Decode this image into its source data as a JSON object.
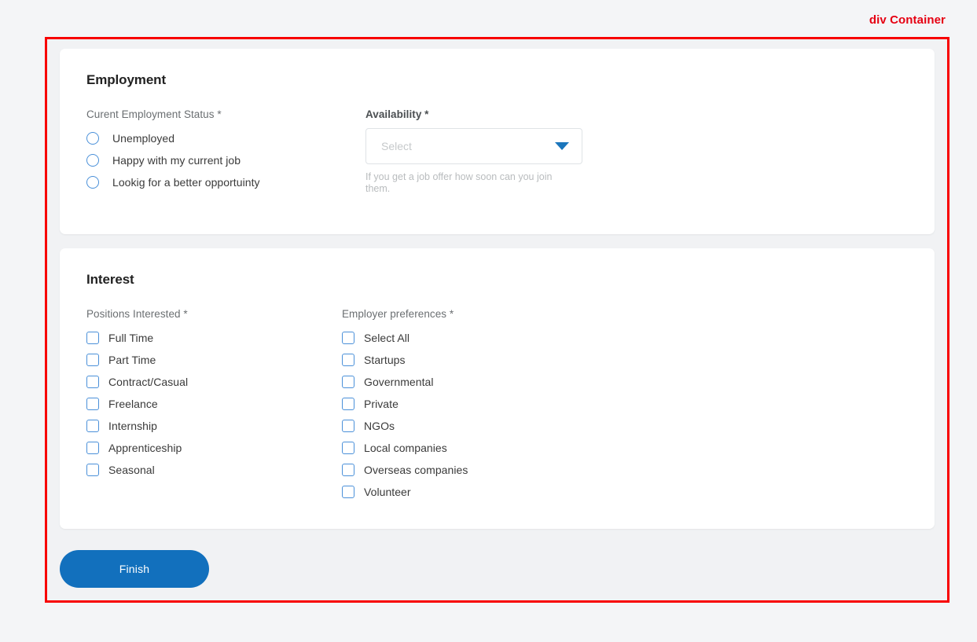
{
  "annotation": {
    "label": "div Container",
    "color": "#e60012"
  },
  "theme": {
    "page_background": "#f4f5f7",
    "container_border": "#f80000",
    "card_background": "#ffffff",
    "accent_blue": "#1270bd",
    "control_border_blue": "#4a90d9"
  },
  "employment_section": {
    "title": "Employment",
    "status_field": {
      "label": "Curent Employment Status *",
      "options": [
        {
          "label": "Unemployed",
          "selected": false
        },
        {
          "label": "Happy with my current job",
          "selected": false
        },
        {
          "label": "Lookig for a better opportuinty",
          "selected": false
        }
      ]
    },
    "availability_field": {
      "label": "Availability *",
      "value": "",
      "placeholder": "Select",
      "helper_text": "If you get a job offer how soon can you join them.",
      "chevron_icon": "chevron-down-icon"
    }
  },
  "interest_section": {
    "title": "Interest",
    "positions_field": {
      "label": "Positions Interested *",
      "options": [
        {
          "label": "Full Time",
          "checked": false
        },
        {
          "label": "Part Time",
          "checked": false
        },
        {
          "label": "Contract/Casual",
          "checked": false
        },
        {
          "label": "Freelance",
          "checked": false
        },
        {
          "label": "Internship",
          "checked": false
        },
        {
          "label": "Apprenticeship",
          "checked": false
        },
        {
          "label": "Seasonal",
          "checked": false
        }
      ]
    },
    "employer_field": {
      "label": "Employer preferences *",
      "options": [
        {
          "label": "Select All",
          "checked": false
        },
        {
          "label": "Startups",
          "checked": false
        },
        {
          "label": "Governmental",
          "checked": false
        },
        {
          "label": "Private",
          "checked": false
        },
        {
          "label": "NGOs",
          "checked": false
        },
        {
          "label": "Local companies",
          "checked": false
        },
        {
          "label": "Overseas companies",
          "checked": false
        },
        {
          "label": "Volunteer",
          "checked": false
        }
      ]
    }
  },
  "footer": {
    "finish_label": "Finish"
  }
}
